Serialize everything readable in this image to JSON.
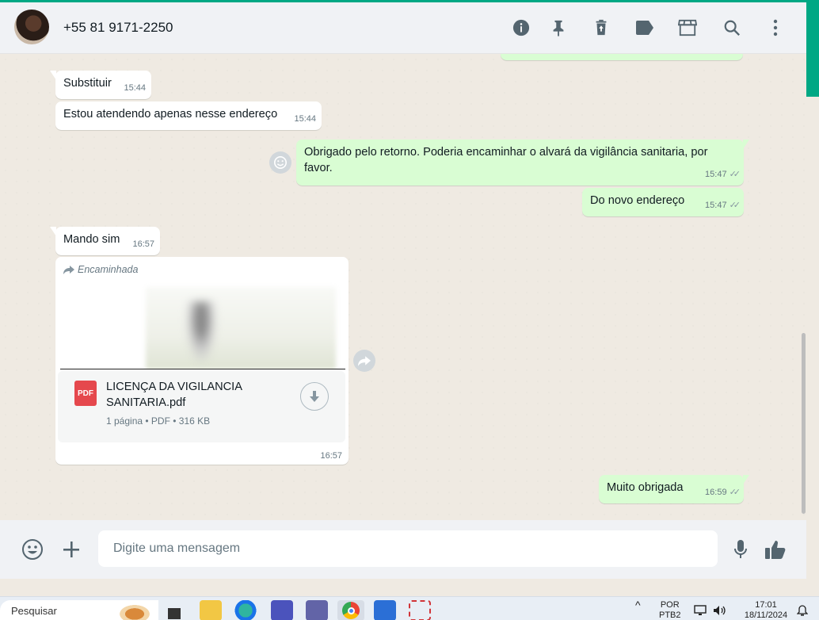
{
  "header": {
    "contact_name": "+55 81 9171-2250",
    "icons": [
      "info-icon",
      "pin-icon",
      "trash-icon",
      "label-icon",
      "store-icon",
      "search-icon",
      "more-icon"
    ]
  },
  "messages": [
    {
      "direction": "in",
      "text": "Substituir",
      "time": "15:44"
    },
    {
      "direction": "in",
      "text": "Estou atendendo apenas nesse endereço",
      "time": "15:44"
    },
    {
      "direction": "out",
      "text": "Obrigado pelo retorno. Poderia encaminhar o alvará da vigilância sanitaria, por favor.",
      "time": "15:47",
      "status": "read"
    },
    {
      "direction": "out",
      "text": "Do novo endereço",
      "time": "15:47",
      "status": "read"
    },
    {
      "direction": "in",
      "text": "Mando sim",
      "time": "16:57"
    },
    {
      "direction": "out",
      "text": "Muito obrigada",
      "time": "16:59",
      "status": "read"
    }
  ],
  "document": {
    "forwarded_label": "Encaminhada",
    "icon_label": "PDF",
    "file_name": "LICENÇA DA VIGILANCIA SANITARIA.pdf",
    "info": "1 página • PDF • 316 KB",
    "time": "16:57"
  },
  "composer": {
    "placeholder": "Digite uma mensagem"
  },
  "taskbar": {
    "search_placeholder": "Pesquisar",
    "lang_line1": "POR",
    "lang_line2": "PTB2",
    "time": "17:01",
    "date": "18/11/2024"
  },
  "colors": {
    "accent": "#00a884",
    "outgoing_bubble": "#d9fdd3",
    "incoming_bubble": "#ffffff",
    "chat_background": "#efeae2",
    "pdf_red": "#e5484d"
  }
}
